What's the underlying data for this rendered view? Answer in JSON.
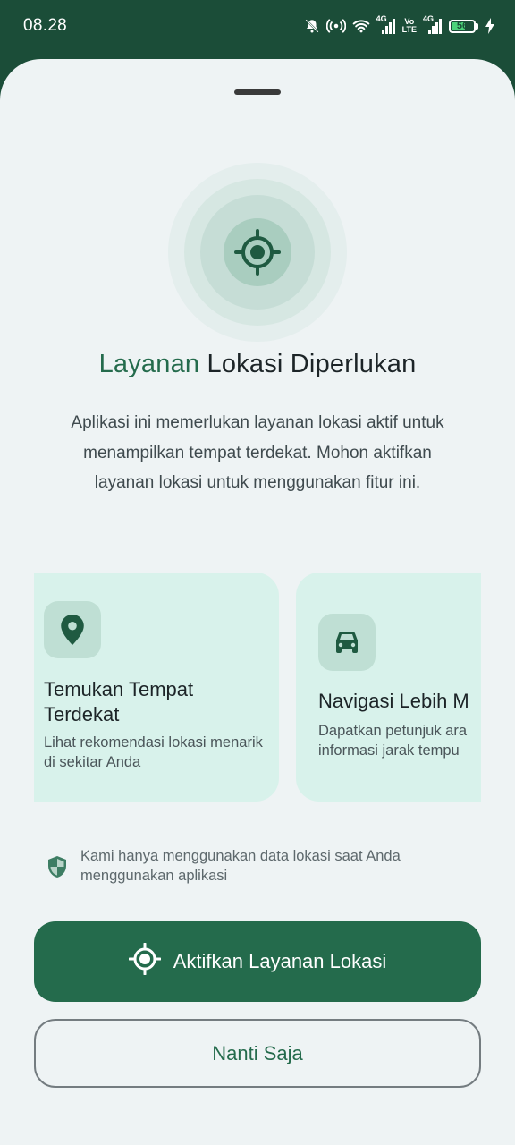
{
  "status_bar": {
    "time": "08.28",
    "net1": "4G",
    "net2_top": "Vo",
    "net2_bottom": "LTE",
    "net3": "4G",
    "battery_level": "56"
  },
  "hero": {
    "title_accent": "Layanan",
    "title_rest": " Lokasi Diperlukan",
    "description": "Aplikasi ini memerlukan layanan lokasi aktif untuk menampilkan tempat terdekat. Mohon aktifkan layanan lokasi untuk menggunakan fitur ini."
  },
  "features": [
    {
      "icon": "map-pin-icon",
      "title": "Temukan Tempat Terdekat",
      "description": "Lihat rekomendasi lokasi menarik di sekitar Anda"
    },
    {
      "icon": "car-icon",
      "title": "Navigasi Lebih M",
      "description_line1": "Dapatkan petunjuk ara",
      "description_line2": "informasi jarak tempu"
    }
  ],
  "privacy_note": "Kami hanya menggunakan data lokasi saat Anda menggunakan aplikasi",
  "actions": {
    "enable_label": "Aktifkan Layanan Lokasi",
    "later_label": "Nanti Saja"
  },
  "colors": {
    "brand": "#246b4c",
    "header": "#1b4d38",
    "card": "#d8f2eb",
    "background": "#eef3f4"
  }
}
